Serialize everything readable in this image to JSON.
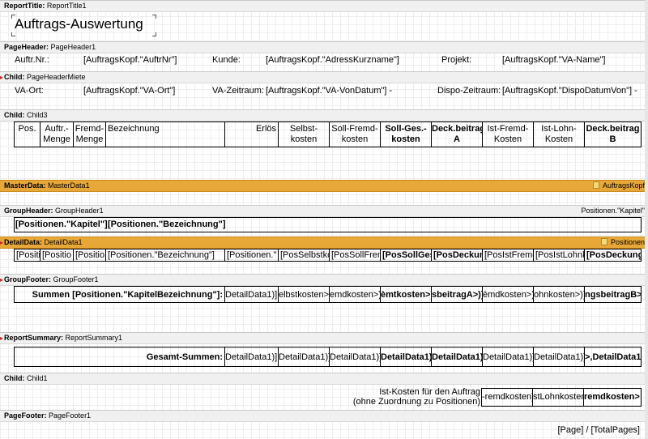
{
  "bands": {
    "report_title": {
      "name": "ReportTitle:",
      "id": "ReportTitle1",
      "text": "Auftrags-Auswertung"
    },
    "page_header": {
      "name": "PageHeader:",
      "id": "PageHeader1",
      "auftr_nr_label": "Auftr.Nr.:",
      "auftr_nr_value": "[AuftragsKopf.\"AuftrNr\"]",
      "kunde_label": "Kunde:",
      "kunde_value": "[AuftragsKopf.\"AdressKurzname\"]",
      "projekt_label": "Projekt:",
      "projekt_value": "[AuftragsKopf.\"VA-Name\"]"
    },
    "child_miete": {
      "name": "Child:",
      "id": "PageHeaderMiete",
      "va_ort_label": "VA-Ort:",
      "va_ort_value": "[AuftragsKopf.\"VA-Ort\"]",
      "va_zeitraum_label": "VA-Zeitraum:",
      "va_zeitraum_value": "[AuftragsKopf.\"VA-VonDatum\"] -",
      "dispo_label": "Dispo-Zeitraum:",
      "dispo_value": "[AuftragsKopf.\"DispoDatumVon\"] -"
    },
    "child3": {
      "name": "Child:",
      "id": "Child3",
      "columns": [
        {
          "l1": "Pos.",
          "l2": ""
        },
        {
          "l1": "Auftr.-",
          "l2": "Menge"
        },
        {
          "l1": "Fremd-",
          "l2": "Menge"
        },
        {
          "l1": "Bezeichnung",
          "l2": ""
        },
        {
          "l1": "Erlös",
          "l2": ""
        },
        {
          "l1": "Selbst-",
          "l2": "kosten"
        },
        {
          "l1": "Soll-Fremd-",
          "l2": "kosten"
        },
        {
          "l1": "Soll-Ges.-",
          "l2": "kosten"
        },
        {
          "l1": "Deck.beitrag",
          "l2": "A"
        },
        {
          "l1": "Ist-Fremd-",
          "l2": "Kosten"
        },
        {
          "l1": "Ist-Lohn-",
          "l2": "Kosten"
        },
        {
          "l1": "Deck.beitrag",
          "l2": "B"
        }
      ]
    },
    "master_data": {
      "name": "MasterData:",
      "id": "MasterData1",
      "source": "AuftragsKopf"
    },
    "group_header": {
      "name": "GroupHeader:",
      "id": "GroupHeader1",
      "condition": "Positionen.\"Kapitel\"",
      "field1": "[Positionen.\"Kapitel\"].",
      "field2": "[Positionen.\"Bezeichnung\"]"
    },
    "detail_data": {
      "name": "DetailData:",
      "id": "DetailData1",
      "source": "Positionen",
      "cells": [
        "[Positi",
        "[Positio",
        "[Positio",
        "[Positionen.\"Bezeichnung\"]",
        "[Positionen.\"",
        "[PosSelbstko",
        "[PosSollFrem",
        "[PosSollGes",
        "[PosDeckun",
        "[PosIstFremd",
        "[PosIstLohnk",
        "[PosDeckung"
      ]
    },
    "group_footer": {
      "name": "GroupFooter:",
      "id": "GroupFooter1",
      "label": "Summen [Positionen.\"KapitelBezeichnung\"]:",
      "cells": [
        "DetailData1)]",
        "elbstkosten>)]",
        "emdkosten>)]",
        "èmtkosten>)]",
        "sbeitragA>)]",
        "èmdkosten>)]",
        "ohnkosten>)]",
        "ngsbeitragB>)]"
      ]
    },
    "report_summary": {
      "name": "ReportSummary:",
      "id": "ReportSummary1",
      "label": "Gesamt-Summen:",
      "cells": [
        "DetailData1)]",
        "DetailData1)]",
        "DetailData1)]",
        "DetailData1)]",
        "DetailData1)]",
        "DetailData1)]",
        "DetailData1)]",
        ">,DetailData1)]"
      ]
    },
    "child1": {
      "name": "Child:",
      "id": "Child1",
      "label_line1": "Ist-Kosten für den Auftrag",
      "label_line2": "(ohne Zuordnung zu Positionen)",
      "cells": [
        "-remdkosten]",
        "stLohnkosten]",
        "remdkosten> ]"
      ]
    },
    "page_footer": {
      "name": "PageFooter:",
      "id": "PageFooter1",
      "text": "[Page] / [TotalPages]"
    }
  }
}
